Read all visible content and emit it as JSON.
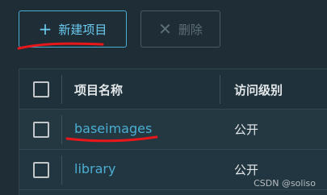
{
  "toolbar": {
    "new_icon": "plus-icon",
    "new_label": "新建项目",
    "delete_icon": "x-icon",
    "delete_label": "删除"
  },
  "table": {
    "columns": [
      "项目名称",
      "访问级别"
    ],
    "rows": [
      {
        "name": "baseimages",
        "access": "公开"
      },
      {
        "name": "library",
        "access": "公开"
      }
    ]
  },
  "watermark": "CSDN @soliso",
  "colors": {
    "accent": "#4aaed1",
    "annotation": "#e8171b",
    "background": "#1e2d36"
  }
}
